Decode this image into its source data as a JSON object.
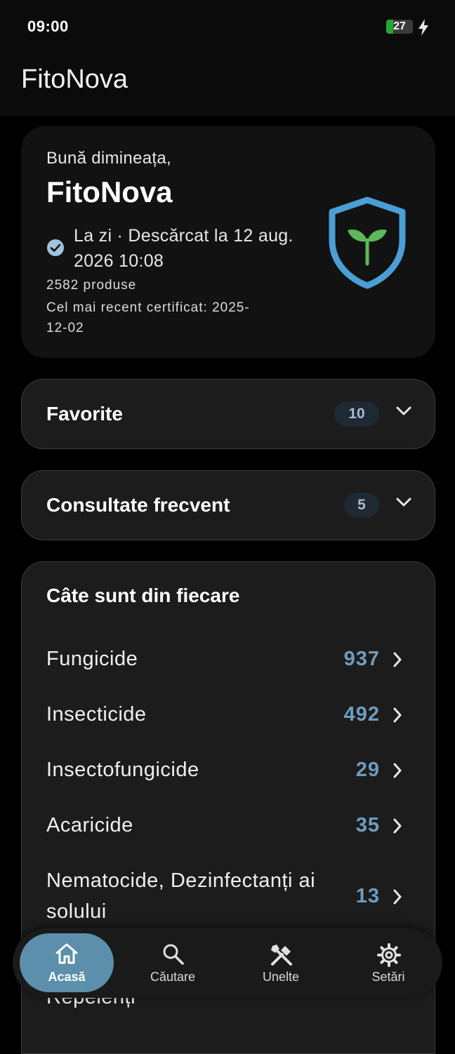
{
  "status_bar": {
    "time": "09:00",
    "battery_level": "27",
    "battery_fraction": 0.27,
    "charging_icon": "bolt-icon"
  },
  "app_bar": {
    "title": "FitoNova"
  },
  "summary": {
    "greeting": "Bună dimineața,",
    "title": "FitoNova",
    "status_icon": "check-circle-icon",
    "status_text": "La zi · Descărcat la 12 aug. 2026 10:08",
    "products_count": "2582 produse",
    "latest_certificate": "Cel mai recent certificat: 2025-12-02",
    "logo_icon": "shield-sprout-icon"
  },
  "favorites": {
    "label": "Favorite",
    "count": "10"
  },
  "frequent": {
    "label": "Consultate frecvent",
    "count": "5"
  },
  "categories": {
    "title": "Câte sunt din fiecare",
    "items": [
      {
        "label": "Fungicide",
        "count": "937"
      },
      {
        "label": "Insecticide",
        "count": "492"
      },
      {
        "label": "Insectofungicide",
        "count": "29"
      },
      {
        "label": "Acaricide",
        "count": "35"
      },
      {
        "label": "Nematocide, Dezinfectanți ai solului",
        "count": "13"
      },
      {
        "label": "Repelenți",
        "count": ""
      }
    ]
  },
  "nav": {
    "items": [
      {
        "label": "Acasă",
        "icon": "home-icon",
        "active": true
      },
      {
        "label": "Căutare",
        "icon": "search-icon",
        "active": false
      },
      {
        "label": "Unelte",
        "icon": "tools-icon",
        "active": false
      },
      {
        "label": "Setări",
        "icon": "gear-icon",
        "active": false
      }
    ]
  },
  "colors": {
    "background": "#000000",
    "card": "#1c1c1c",
    "summary_card": "#121212",
    "accent": "#5b8fab",
    "count_text": "#6f9cbf",
    "shield": "#4a9fd5",
    "sprout": "#5cb85c",
    "battery": "#23a834"
  }
}
